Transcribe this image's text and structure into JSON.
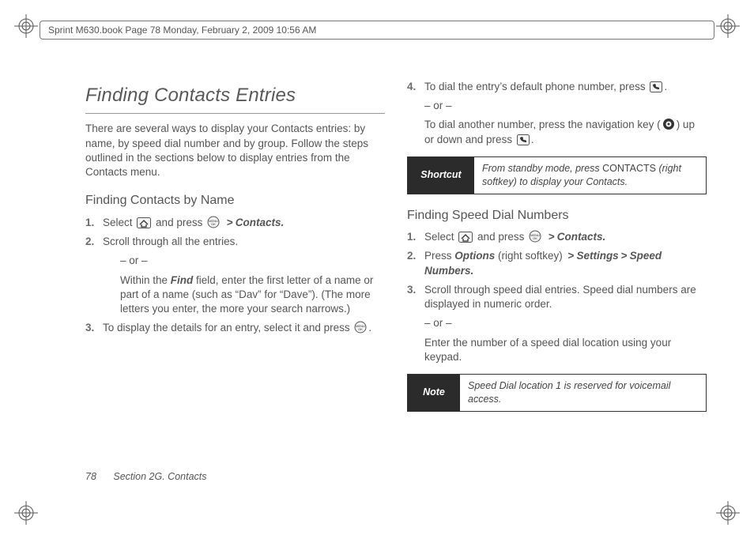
{
  "header_bar": "Sprint M630.book  Page 78  Monday, February 2, 2009  10:56 AM",
  "footer": {
    "page_number": "78",
    "section": "Section 2G. Contacts"
  },
  "left": {
    "title": "Finding Contacts Entries",
    "lead": "There are several ways to display your Contacts entries: by name, by speed dial number and by group. Follow the steps outlined in the sections below to display entries from the Contacts menu.",
    "h_by_name": "Finding Contacts by Name",
    "s1a": "Select ",
    "s1b": " and press ",
    "s1c": "Contacts.",
    "s2": "Scroll through all the entries.",
    "s2_or": "– or –",
    "s2_within_a": "Within the ",
    "s2_find": "Find",
    "s2_within_b": " field, enter the first letter of a name or part of a name (such as “Dav” for “Dave”). (The more letters you enter, the more your search narrows.)",
    "s3a": "To display the details for an entry, select it and press ",
    "s3b": "."
  },
  "right": {
    "s4a": "To dial the entry’s default phone number, press ",
    "s4b": ".",
    "s4_or": "– or –",
    "s4c_a": "To dial another number, press the navigation key (",
    "s4c_b": ") up or down and press ",
    "s4c_c": ".",
    "shortcut_lbl": "Shortcut",
    "shortcut_a": "From standby mode, press ",
    "shortcut_contacts": "CONTACTS",
    "shortcut_b": " (",
    "shortcut_rsk": "right softkey",
    "shortcut_c": ") to display your Contacts.",
    "h_speed": "Finding Speed Dial Numbers",
    "sp1a": "Select ",
    "sp1b": " and press ",
    "sp1c": "Contacts.",
    "sp2a": "Press ",
    "sp2_opt": "Options",
    "sp2b": " (right softkey) ",
    "sp2_set": "Settings",
    "sp2_sd": "Speed Numbers.",
    "sp3": "Scroll through speed dial entries. Speed dial numbers are displayed in numeric order.",
    "sp3_or": "– or –",
    "sp3b": "Enter the number of a speed dial location using your keypad.",
    "note_lbl": "Note",
    "note_txt": "Speed Dial location 1 is reserved for voicemail access."
  },
  "gt": ">"
}
